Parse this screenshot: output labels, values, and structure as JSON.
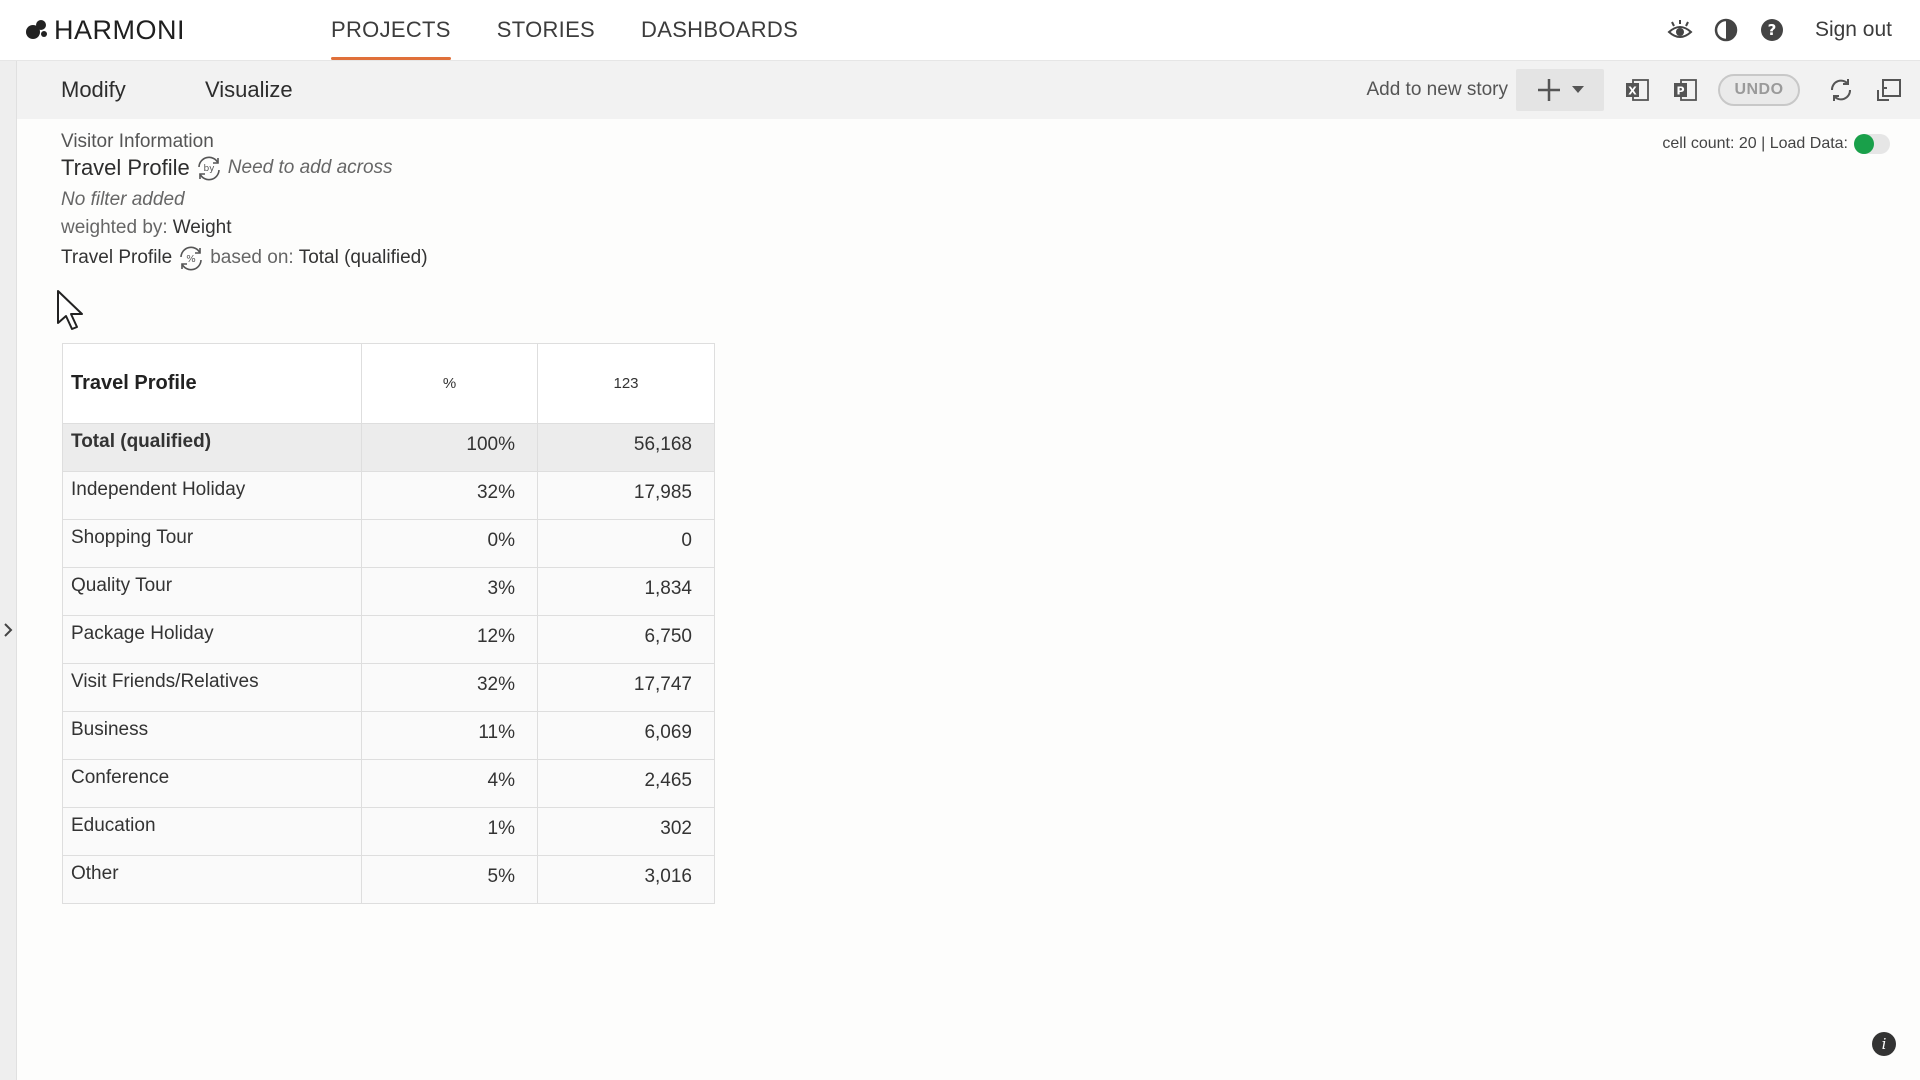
{
  "app": {
    "name": "HARMONI"
  },
  "nav": {
    "items": [
      "PROJECTS",
      "STORIES",
      "DASHBOARDS"
    ],
    "active": 0
  },
  "top_right": {
    "signout": "Sign out",
    "icons": [
      "eye-icon",
      "contrast-icon",
      "help-icon"
    ]
  },
  "toolbar": {
    "tabs": [
      "Modify",
      "Visualize"
    ],
    "add_to_story": "Add to new story",
    "undo": "UNDO",
    "icons": [
      "add-icon",
      "excel-export-icon",
      "powerpoint-export-icon",
      "refresh-icon",
      "reset-icon"
    ]
  },
  "info": {
    "category": "Visitor Information",
    "title": "Travel Profile",
    "by_note": "Need to add across",
    "filter": "No filter added",
    "weighted_prefix": "weighted by:",
    "weighted_value": "Weight",
    "pct_label": "Travel Profile",
    "based_prefix": "based on:",
    "based_value": "Total (qualified)"
  },
  "cell_info": {
    "text": "cell count: 20 | Load Data:",
    "load_data_on": true
  },
  "table": {
    "headers": [
      "Travel Profile",
      "%",
      "123"
    ],
    "rows": [
      {
        "label": "Total (qualified)",
        "pct": "100%",
        "count": "56,168"
      },
      {
        "label": "Independent Holiday",
        "pct": "32%",
        "count": "17,985"
      },
      {
        "label": "Shopping Tour",
        "pct": "0%",
        "count": "0"
      },
      {
        "label": "Quality Tour",
        "pct": "3%",
        "count": "1,834"
      },
      {
        "label": "Package Holiday",
        "pct": "12%",
        "count": "6,750"
      },
      {
        "label": "Visit Friends/Relatives",
        "pct": "32%",
        "count": "17,747"
      },
      {
        "label": "Business",
        "pct": "11%",
        "count": "6,069"
      },
      {
        "label": "Conference",
        "pct": "4%",
        "count": "2,465"
      },
      {
        "label": "Education",
        "pct": "1%",
        "count": "302"
      },
      {
        "label": "Other",
        "pct": "5%",
        "count": "3,016"
      }
    ]
  },
  "info_button": "i",
  "colors": {
    "accent": "#e0703a",
    "toggle_on": "#19a04a"
  }
}
